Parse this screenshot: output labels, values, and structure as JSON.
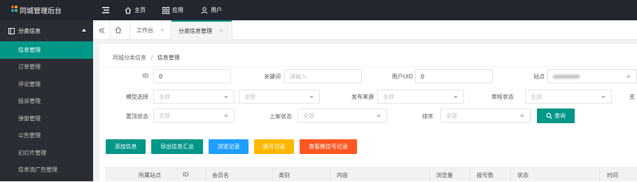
{
  "app": {
    "title": "同城管理后台"
  },
  "topnav": {
    "home": "主页",
    "apps": "应用",
    "user": "用户"
  },
  "sidebar": {
    "section": "分类信息",
    "items": [
      {
        "label": "信息管理"
      },
      {
        "label": "订单管理"
      },
      {
        "label": "评论管理"
      },
      {
        "label": "投诉管理"
      },
      {
        "label": "弹窗管理"
      },
      {
        "label": "公告管理"
      },
      {
        "label": "幻灯片管理"
      },
      {
        "label": "信息流广告管理"
      }
    ]
  },
  "tabs": [
    {
      "label": "工作台",
      "close": "×"
    },
    {
      "label": "分类信息管理",
      "close": "×"
    }
  ],
  "breadcrumb": {
    "parent": "同城分类信息",
    "sep": "/",
    "current": "信息管理"
  },
  "filters": {
    "id": {
      "label": "ID",
      "value": "0"
    },
    "keyword": {
      "label": "关键词",
      "placeholder": "请输入"
    },
    "uid": {
      "label": "用户UID",
      "value": "0"
    },
    "site": {
      "label": "站点"
    },
    "model": {
      "label": "模型选择",
      "value": "全部"
    },
    "model2": {
      "value": "全部"
    },
    "source": {
      "label": "发布来源",
      "value": "全部"
    },
    "audit": {
      "label": "审核状态",
      "value": "全部"
    },
    "extra": {
      "label": "支"
    },
    "top": {
      "label": "置顶状态",
      "value": "全部"
    },
    "shelf": {
      "label": "上架状态",
      "value": "全部"
    },
    "sort": {
      "label": "排序",
      "value": "全部"
    },
    "search": "查询"
  },
  "actions": {
    "add": "添加信息",
    "export": "导出信息汇总",
    "browse": "浏览记录",
    "dial": "拨号记录",
    "wechat": "查看微信号记录"
  },
  "table": {
    "columns": [
      "所属站点",
      "ID",
      "会员名",
      "类别",
      "内容",
      "浏览量",
      "拨号数",
      "状态",
      "时间"
    ]
  },
  "colors": {
    "brand": "#009688",
    "blue": "#1e9fff",
    "orange": "#ffb800",
    "red": "#ff5722",
    "dark": "#23262e"
  }
}
